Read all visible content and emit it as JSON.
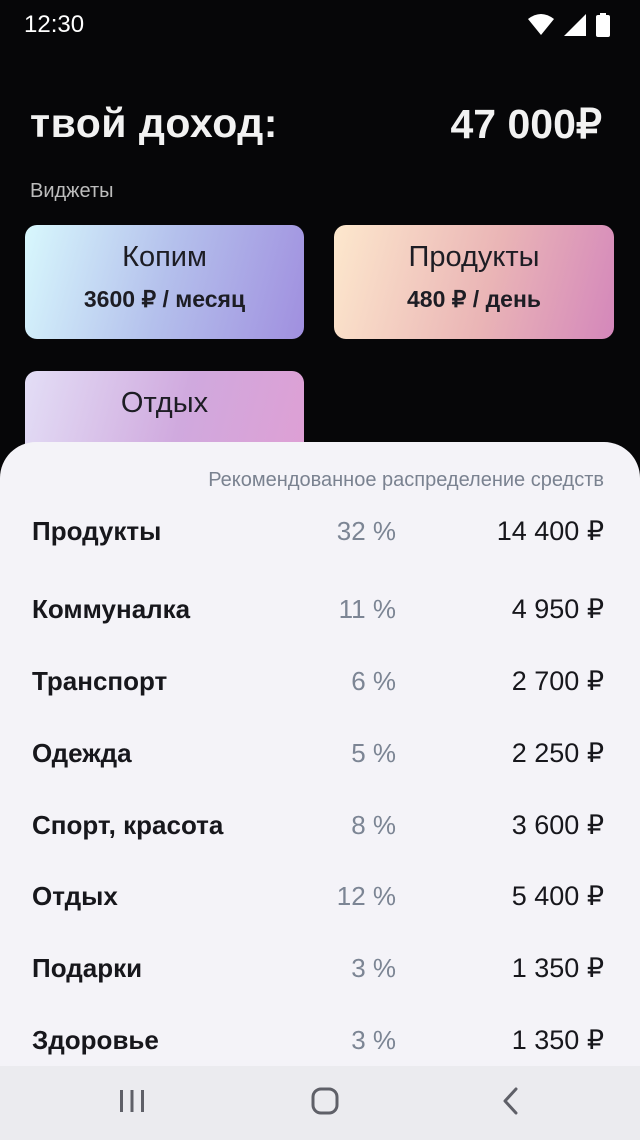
{
  "status_bar": {
    "time": "12:30",
    "icons": [
      "wifi-icon",
      "signal-icon",
      "battery-icon"
    ]
  },
  "header": {
    "income_label": "твой доход:",
    "income_value": "47 000₽"
  },
  "widgets_label": "Виджеты",
  "widgets": [
    {
      "title": "Копим",
      "subtitle": "3600 ₽ / месяц"
    },
    {
      "title": "Продукты",
      "subtitle": "480 ₽ / день"
    },
    {
      "title": "Отдых",
      "subtitle": ""
    }
  ],
  "sheet": {
    "caption": "Рекомендованное распределение средств",
    "rows": [
      {
        "name": "Продукты",
        "percent": "32 %",
        "amount": "14 400 ₽"
      },
      {
        "name": "Коммуналка",
        "percent": "11 %",
        "amount": "4 950 ₽"
      },
      {
        "name": "Транспорт",
        "percent": "6 %",
        "amount": "2 700 ₽"
      },
      {
        "name": "Одежда",
        "percent": "5 %",
        "amount": "2 250 ₽"
      },
      {
        "name": "Спорт, красота",
        "percent": "8 %",
        "amount": "3 600 ₽"
      },
      {
        "name": "Отдых",
        "percent": "12 %",
        "amount": "5 400 ₽"
      },
      {
        "name": "Подарки",
        "percent": "3 %",
        "amount": "1 350 ₽"
      },
      {
        "name": "Здоровье",
        "percent": "3 %",
        "amount": "1 350 ₽"
      }
    ]
  },
  "nav": {
    "icons": [
      "recent-apps-icon",
      "home-icon",
      "back-icon"
    ]
  },
  "colors": {
    "background": "#060608",
    "sheet": "#f4f3f8",
    "percent_text": "#7c8594"
  }
}
